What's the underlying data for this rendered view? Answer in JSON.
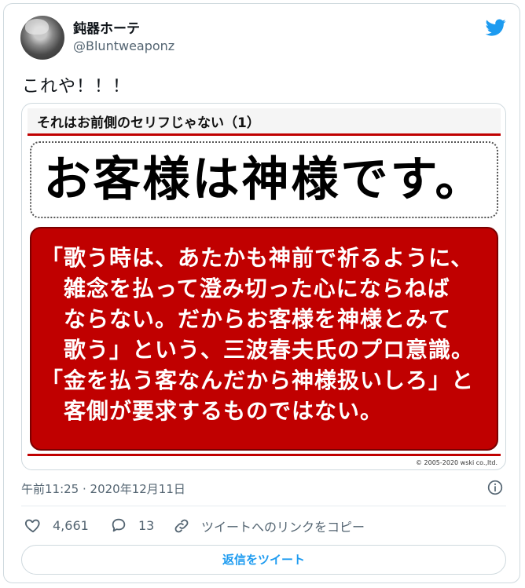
{
  "user": {
    "display_name": "鈍器ホーテ",
    "handle": "@Bluntweaponz"
  },
  "tweet": {
    "text": "これや！！！",
    "timestamp": "午前11:25 · 2020年12月11日"
  },
  "image": {
    "header": "それはお前側のセリフじゃない（1）",
    "headline": "お客様は神様です。",
    "quote_lines": [
      "「歌う時は、あたかも神前で祈るように、",
      "　雑念を払って澄み切った心にならねば",
      "　ならない。だからお客様を神様とみて",
      "　歌う」という、三波春夫氏のプロ意識。",
      "「金を払う客なんだから神様扱いしろ」と",
      "　客側が要求するものではない。"
    ],
    "copyright": "© 2005-2020 wski co.,ltd."
  },
  "actions": {
    "likes": "4,661",
    "replies": "13",
    "copy_link": "ツイートへのリンクをコピー"
  },
  "reply_button": "返信をツイート",
  "icons": {
    "brand": "twitter-bird-icon",
    "info": "info-icon",
    "like": "heart-icon",
    "reply": "speech-bubble-icon",
    "link": "link-icon"
  },
  "colors": {
    "accent": "#1d9bf0",
    "image_red": "#c00000"
  }
}
